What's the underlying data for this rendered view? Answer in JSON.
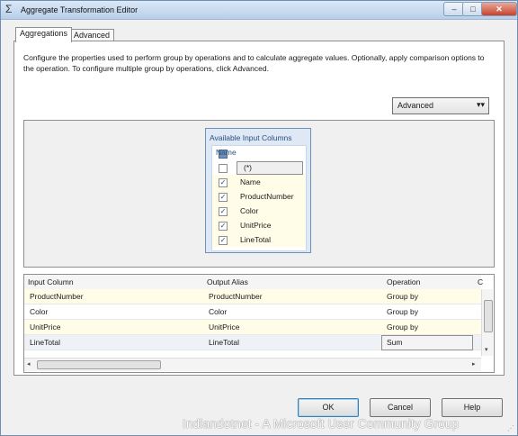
{
  "window": {
    "title": "Aggregate Transformation Editor",
    "app_icon": "sigma-icon",
    "controls": {
      "minimize": "–",
      "maximize": "□",
      "close": "✕"
    }
  },
  "tabs": [
    {
      "label": "Aggregations",
      "active": true
    },
    {
      "label": "Advanced",
      "active": false
    }
  ],
  "description": "Configure the properties used to perform group by operations and to calculate aggregate values. Optionally, apply comparison options to the operation. To configure multiple group by operations, click Advanced.",
  "advanced_dropdown": {
    "label": "Advanced",
    "icon": "double-chevron-down-icon"
  },
  "available_columns": {
    "header": "Available Input Columns",
    "column_header": "Name",
    "rows": [
      {
        "name": "(*)",
        "checked": false
      },
      {
        "name": "Name",
        "checked": true
      },
      {
        "name": "ProductNumber",
        "checked": true
      },
      {
        "name": "Color",
        "checked": true
      },
      {
        "name": "UnitPrice",
        "checked": true
      },
      {
        "name": "LineTotal",
        "checked": true
      }
    ]
  },
  "grid": {
    "headers": [
      "Input Column",
      "Output Alias",
      "Operation",
      "C"
    ],
    "rows": [
      {
        "input": "ProductNumber",
        "alias": "ProductNumber",
        "operation": "Group by"
      },
      {
        "input": "Color",
        "alias": "Color",
        "operation": "Group by"
      },
      {
        "input": "UnitPrice",
        "alias": "UnitPrice",
        "operation": "Group by"
      },
      {
        "input": "LineTotal",
        "alias": "LineTotal",
        "operation": "Sum"
      }
    ]
  },
  "buttons": {
    "ok": "OK",
    "cancel": "Cancel",
    "help": "Help"
  },
  "watermark": "Indiandotnet - A Microsoft User Community Group"
}
